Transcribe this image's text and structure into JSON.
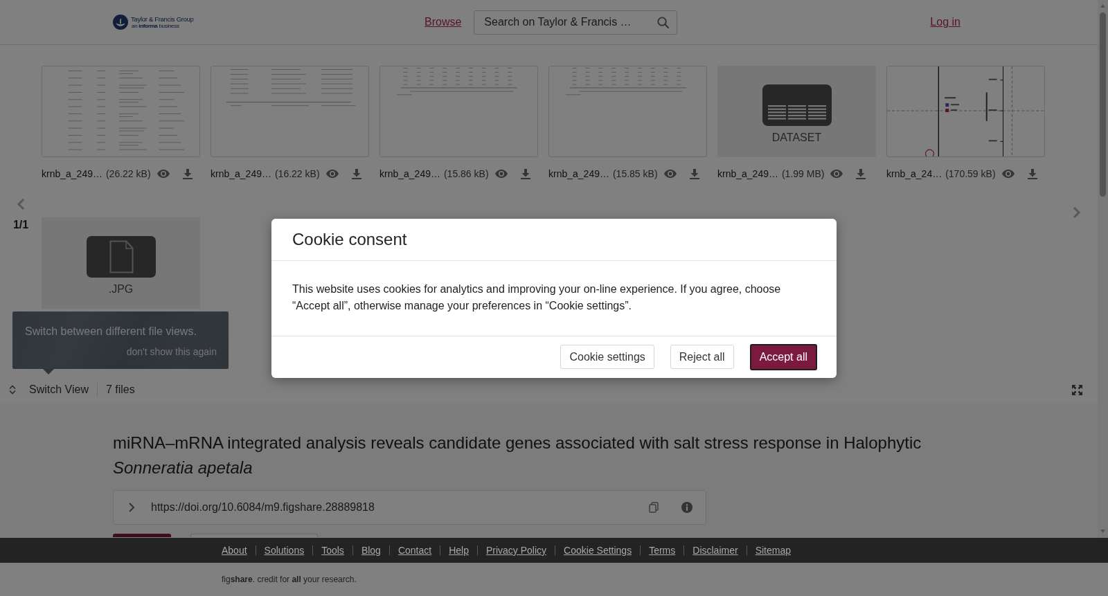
{
  "header": {
    "logo": {
      "name": "Taylor & Francis Group",
      "tagline": "an **informa** business"
    },
    "nav_link": "Browse",
    "search": {
      "placeholder": "Search on Taylor & Francis …"
    },
    "login": "Log in"
  },
  "files": [
    {
      "kind": "table",
      "name": "krnb_a_249…",
      "size": "(26.22 kB)"
    },
    {
      "kind": "table",
      "name": "krnb_a_249…",
      "size": "(16.22 kB)"
    },
    {
      "kind": "table",
      "name": "krnb_a_249…",
      "size": "(15.86 kB)"
    },
    {
      "kind": "table",
      "name": "krnb_a_249…",
      "size": "(15.85 kB)"
    },
    {
      "kind": "dataset",
      "label": "DATASET",
      "name": "krnb_a_249…",
      "size": "(1.99 MB)"
    },
    {
      "kind": "plot",
      "name": "krnb_a_24…",
      "size": "(170.59 kB)"
    }
  ],
  "pager": {
    "position": "1/1"
  },
  "more_files": [
    {
      "kind": "file",
      "label": ".JPG"
    }
  ],
  "tooltip": {
    "text": "Switch between different file views.",
    "dismiss": "don't show this again"
  },
  "toolbar": {
    "switch_view": "Switch View",
    "file_count": "7 files"
  },
  "article": {
    "title": "miRNA–mRNA integrated analysis reveals candidate genes associated with salt stress response in Halophytic *Sonneratia apetala*",
    "doi": "https://doi.org/10.6084/m9.figshare.28889818"
  },
  "footer": {
    "links": [
      "About",
      "Solutions",
      "Tools",
      "Blog",
      "Contact",
      "Help",
      "Privacy Policy",
      "Cookie Settings",
      "Terms",
      "Disclaimer",
      "Sitemap"
    ],
    "tagline": "fig**share**. credit for **all** your research."
  },
  "cookie_dialog": {
    "title": "Cookie consent",
    "text": "This website uses cookies for analytics and improving your on-line experience. If you agree, choose “Accept all”, otherwise manage your preferences in “Cookie settings”.",
    "buttons": [
      {
        "label": "Cookie settings",
        "kind": "secondary"
      },
      {
        "label": "Reject all",
        "kind": "secondary"
      },
      {
        "label": "Accept all",
        "kind": "primary"
      }
    ]
  }
}
